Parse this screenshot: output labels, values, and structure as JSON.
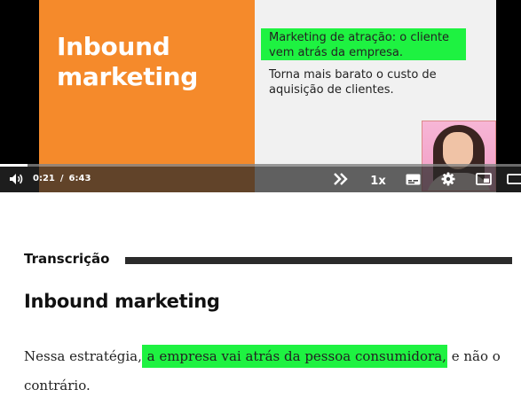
{
  "video": {
    "slide": {
      "title_line1": "Inbound",
      "title_line2": "marketing",
      "highlight_line1": "Marketing de atração: o cliente",
      "highlight_line2": "vem atrás da empresa.",
      "body_line1": "Torna mais barato o custo de",
      "body_line2": "aquisição de clientes."
    },
    "player": {
      "current_time": "0:21",
      "separator": "/",
      "duration": "6:43",
      "progress_fraction": 0.052,
      "speed": "1x"
    }
  },
  "transcript": {
    "label": "Transcrição",
    "title": "Inbound marketing",
    "paragraph_before": "Nessa estratégia,",
    "paragraph_highlight": " a empresa vai atrás da pessoa consumidora,",
    "paragraph_after": " e não o contrário."
  },
  "colors": {
    "slide_orange": "#f58a2b",
    "highlight_green": "#1ef241"
  }
}
